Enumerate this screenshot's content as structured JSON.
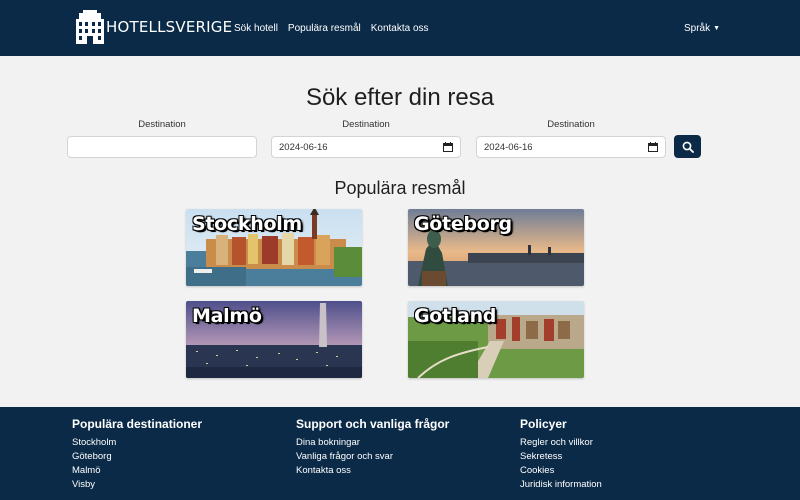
{
  "nav": {
    "brand": "HOTELLSVERIGE",
    "links": [
      "Sök hotell",
      "Populära resmål",
      "Kontakta oss"
    ],
    "language": "Språk"
  },
  "search": {
    "title": "Sök efter din resa",
    "labels": [
      "Destination",
      "Destination",
      "Destination"
    ],
    "destination_value": "",
    "date_from": "2024-06-16",
    "date_to": "2024-06-16"
  },
  "popular": {
    "title": "Populära resmål",
    "cards": [
      "Stockholm",
      "Göteborg",
      "Malmö",
      "Gotland"
    ]
  },
  "footer": {
    "columns": [
      {
        "heading": "Populära destinationer",
        "links": [
          "Stockholm",
          "Göteborg",
          "Malmö",
          "Visby"
        ]
      },
      {
        "heading": "Support och vanliga frågor",
        "links": [
          "Dina bokningar",
          "Vanliga frågor och svar",
          "Kontakta oss"
        ]
      },
      {
        "heading": "Policyer",
        "links": [
          "Regler och villkor",
          "Sekretess",
          "Cookies",
          "Juridisk information"
        ]
      }
    ]
  },
  "colors": {
    "navy": "#0b2a47",
    "background": "#f2f2f2"
  }
}
